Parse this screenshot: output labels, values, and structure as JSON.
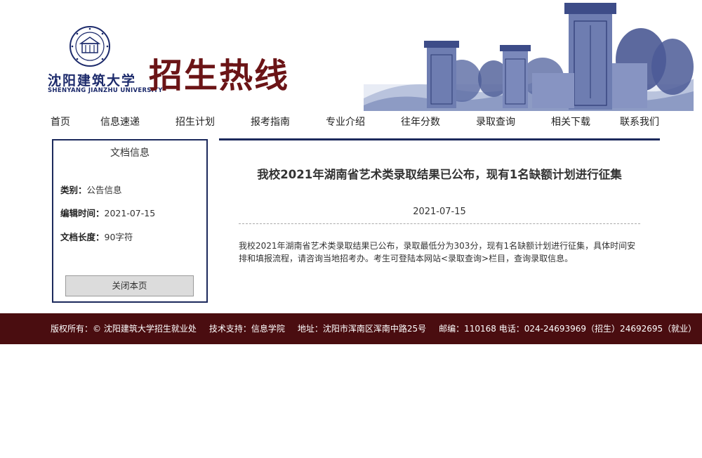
{
  "header": {
    "logo_cn": "沈阳建筑大学",
    "logo_en": "SHENYANG JIANZHU UNIVERSITY",
    "site_title": "招生热线"
  },
  "nav": {
    "items": [
      "首页",
      "信息速递",
      "招生计划",
      "报考指南",
      "专业介绍",
      "往年分数",
      "录取查询",
      "相关下载",
      "联系我们"
    ]
  },
  "sidebar": {
    "title": "文档信息",
    "category_label": "类别：",
    "category_value": "公告信息",
    "edit_time_label": "编辑时间：",
    "edit_time_value": "2021-07-15",
    "length_label": "文档长度：",
    "length_value": "90字符",
    "close_button": "关闭本页"
  },
  "article": {
    "title": "我校2021年湖南省艺术类录取结果已公布，现有1名缺额计划进行征集",
    "date": "2021-07-15",
    "body": "我校2021年湖南省艺术类录取结果已公布，录取最低分为303分，现有1名缺额计划进行征集，具体时间安排和填报流程，请咨询当地招考办。考生可登陆本网站<录取查询>栏目，查询录取信息。"
  },
  "footer": {
    "copyright": "版权所有：© 沈阳建筑大学招生就业处",
    "tech_support": "技术支持：信息学院",
    "address": "地址：沈阳市浑南区浑南中路25号",
    "contact": "邮编：110168 电话：024-24693969（招生）24692695（就业）"
  },
  "colors": {
    "brand_red": "#6b1416",
    "navy": "#1c2a5c",
    "footer_bg": "#4a0d10"
  }
}
